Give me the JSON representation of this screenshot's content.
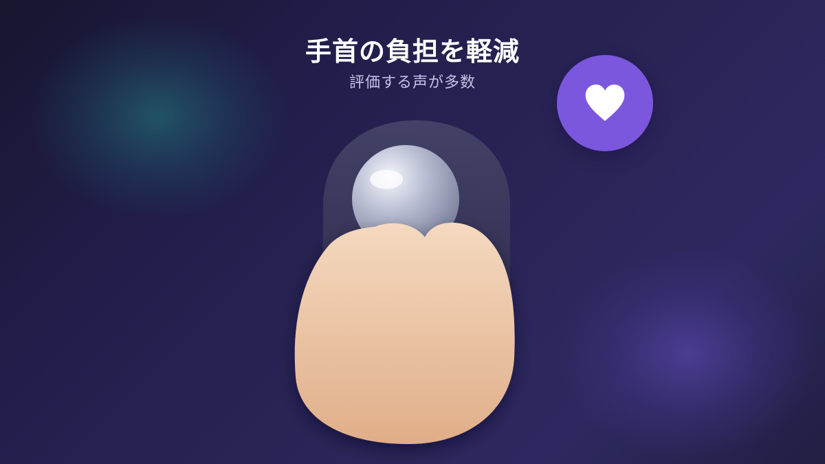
{
  "headline": "手首の負担を軽減",
  "subheadline": "評価する声が多数",
  "badge": {
    "icon": "heart-icon",
    "color": "#7b57dd"
  },
  "illustration": {
    "device": "trackball-mouse-icon",
    "hand": "finger-icon",
    "skin_color": "#eac3a0",
    "ball_color": "#c9ccdc"
  },
  "background": {
    "base": "#221e4b",
    "glow_left": "#225c6c",
    "glow_right": "#4e3e96"
  }
}
